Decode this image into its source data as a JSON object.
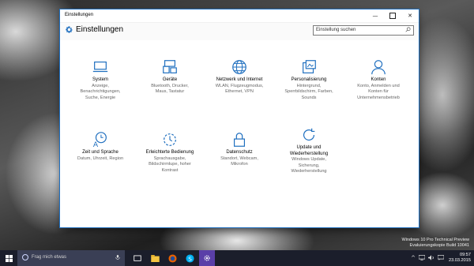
{
  "window": {
    "title": "Einstellungen",
    "controls": {
      "minimize": "—",
      "close": "✕"
    }
  },
  "header": {
    "title": "Einstellungen",
    "search_placeholder": "Einstellung suchen",
    "accent": "#1f6fbf"
  },
  "categories": [
    {
      "title": "System",
      "desc": [
        "Anzeige,",
        "Benachrichtigungen,",
        "Suche, Energie"
      ],
      "icon": "laptop-icon"
    },
    {
      "title": "Geräte",
      "desc": [
        "Bluetooth, Drucker,",
        "Maus, Tastatur"
      ],
      "icon": "devices-icon"
    },
    {
      "title": "Netzwerk und Internet",
      "desc": [
        "WLAN, Flugzeugmodus,",
        "Ethernet, VPN"
      ],
      "icon": "globe-icon"
    },
    {
      "title": "Personalisierung",
      "desc": [
        "Hintergrund,",
        "Sperrbildschirm, Farben,",
        "Sounds"
      ],
      "icon": "paint-icon"
    },
    {
      "title": "Konten",
      "desc": [
        "Konto, Anmelden und",
        "Konten für",
        "Unternehmensbetrieb"
      ],
      "icon": "person-icon"
    },
    {
      "title": "Zeit und Sprache",
      "desc": [
        "Datum, Uhrzeit, Region"
      ],
      "icon": "time-language-icon"
    },
    {
      "title": "Erleichterte Bedienung",
      "desc": [
        "Sprachausgabe,",
        "Bildschirmlupe, hoher",
        "Kontrast"
      ],
      "icon": "ease-of-access-icon"
    },
    {
      "title": "Datenschutz",
      "desc": [
        "Standort, Webcam,",
        "Mikrofon"
      ],
      "icon": "lock-icon"
    },
    {
      "title": "Update und",
      "title2": "Wiederherstellung",
      "desc": [
        "Windows Update,",
        "Sicherung,",
        "Wiederherstellung"
      ],
      "icon": "refresh-icon"
    }
  ],
  "watermark": {
    "line1": "Windows 10 Pro Technical Preview",
    "line2": "Evaluierungskopie Build 10041"
  },
  "taskbar": {
    "search_placeholder": "Frag mich etwas",
    "time": "09:57",
    "date": "23.03.2015",
    "tray_arrow": "^"
  }
}
